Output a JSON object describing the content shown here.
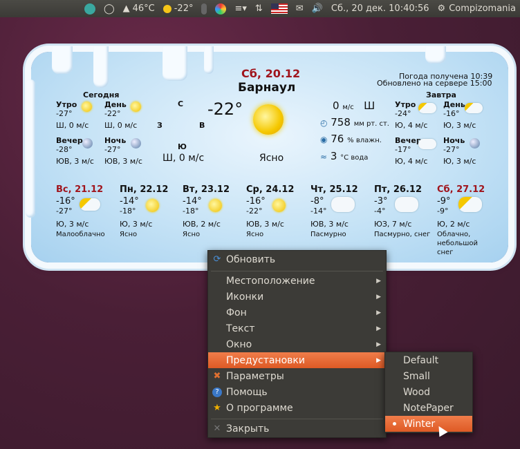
{
  "panel": {
    "temp_cpu": "46°C",
    "weather_temp": "-22°",
    "clock": "Сб., 20 дек. 10:40:56",
    "user": "Compizomania"
  },
  "widget": {
    "today_label": "Сегодня",
    "tomorrow_label": "Завтра",
    "date": "Сб, 20.12",
    "city": "Барнаул",
    "received": "Погода получена 10:39",
    "updated": "Обновлено на сервере 15:00",
    "compass": {
      "n": "С",
      "w": "З",
      "e": "В",
      "s": "Ю"
    },
    "main_temp": "-22°",
    "wind": "Ш, 0 м/с",
    "condition": "Ясно",
    "wind_speed": "0",
    "wind_unit": "м/с",
    "wind_dir": "Ш",
    "pressure": "758",
    "pressure_unit": "мм рт. ст.",
    "humidity": "76",
    "humidity_unit": "% влажн.",
    "water": "3",
    "water_unit": "°C вода",
    "today": [
      {
        "name": "Утро",
        "temp": "-27°",
        "wind": "Ш, 0 м/с"
      },
      {
        "name": "День",
        "temp": "-22°",
        "wind": "Ш, 0 м/с"
      },
      {
        "name": "Вечер",
        "temp": "-28°",
        "wind": "ЮВ, 3 м/с"
      },
      {
        "name": "Ночь",
        "temp": "-27°",
        "wind": "ЮВ, 3 м/с"
      }
    ],
    "tomorrow": [
      {
        "name": "Утро",
        "temp": "-24°",
        "wind": "Ю, 4 м/с"
      },
      {
        "name": "День",
        "temp": "-16°",
        "wind": "Ю, 3 м/с"
      },
      {
        "name": "Вечер",
        "temp": "-17°",
        "wind": "Ю, 4 м/с"
      },
      {
        "name": "Ночь",
        "temp": "-27°",
        "wind": "Ю, 3 м/с"
      }
    ],
    "forecast": [
      {
        "day": "Вс, 21.12",
        "hi": "-16°",
        "lo": "-27°",
        "wind": "Ю, 3 м/с",
        "desc": "Малооблачно"
      },
      {
        "day": "Пн, 22.12",
        "hi": "-14°",
        "lo": "-18°",
        "wind": "Ю, 3 м/с",
        "desc": "Ясно"
      },
      {
        "day": "Вт, 23.12",
        "hi": "-14°",
        "lo": "-18°",
        "wind": "ЮВ, 2 м/с",
        "desc": "Ясно"
      },
      {
        "day": "Ср, 24.12",
        "hi": "-16°",
        "lo": "-22°",
        "wind": "ЮВ, 3 м/с",
        "desc": "Ясно"
      },
      {
        "day": "Чт, 25.12",
        "hi": "-8°",
        "lo": "-14°",
        "wind": "ЮВ, 3 м/с",
        "desc": "Пасмурно"
      },
      {
        "day": "Пт, 26.12",
        "hi": "-3°",
        "lo": "-4°",
        "wind": "ЮЗ, 7 м/с",
        "desc": "Пасмурно, снег"
      },
      {
        "day": "Сб, 27.12",
        "hi": "-9°",
        "lo": "-9°",
        "wind": "Ю, 2 м/с",
        "desc1": "Облачно,",
        "desc2": "небольшой",
        "desc3": "снег"
      }
    ]
  },
  "menu": {
    "refresh": "Обновить",
    "location": "Местоположение",
    "icons": "Иконки",
    "background": "Фон",
    "text": "Текст",
    "window": "Окно",
    "presets": "Предустановки",
    "settings": "Параметры",
    "help": "Помощь",
    "about": "О программе",
    "close": "Закрыть"
  },
  "submenu": {
    "items": [
      "Default",
      "Small",
      "Wood",
      "NotePaper",
      "Winter"
    ]
  }
}
